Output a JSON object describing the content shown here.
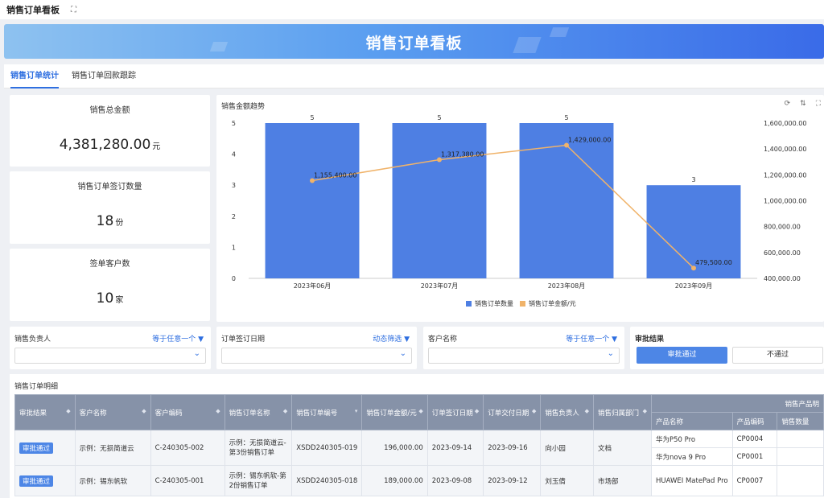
{
  "topbar": {
    "title": "销售订单看板",
    "fullscreen_icon": "expand-icon"
  },
  "banner": {
    "title": "销售订单看板"
  },
  "tabs": [
    {
      "label": "销售订单统计",
      "active": true
    },
    {
      "label": "销售订单回款跟踪",
      "active": false
    }
  ],
  "kpis": [
    {
      "label": "销售总金额",
      "value": "4,381,280.00",
      "unit": "元"
    },
    {
      "label": "销售订单签订数量",
      "value": "18",
      "unit": "份"
    },
    {
      "label": "签单客户数",
      "value": "10",
      "unit": "家"
    }
  ],
  "chart_panel": {
    "title": "销售金额趋势",
    "tools": [
      "refresh-icon",
      "sort-icon",
      "fullscreen-icon"
    ]
  },
  "chart_data": {
    "type": "bar",
    "categories": [
      "2023年06月",
      "2023年07月",
      "2023年08月",
      "2023年09月"
    ],
    "series": [
      {
        "name": "销售订单数量",
        "type": "bar",
        "values": [
          5,
          5,
          5,
          3
        ],
        "labels": [
          "5",
          "5",
          "5",
          "3"
        ],
        "color": "#4e7fe3"
      },
      {
        "name": "销售订单金额/元",
        "type": "line",
        "values": [
          1155400,
          1317380,
          1429000,
          479500
        ],
        "labels": [
          "1,155,400.00",
          "1,317,380.00",
          "1,429,000.00",
          "479,500.00"
        ],
        "color": "#f0b36a"
      }
    ],
    "y_left": {
      "ticks": [
        "0",
        "1",
        "2",
        "3",
        "4",
        "5"
      ],
      "ylim": [
        0,
        5
      ]
    },
    "y_right": {
      "ticks": [
        "400,000.00",
        "600,000.00",
        "800,000.00",
        "1,000,000.00",
        "1,200,000.00",
        "1,400,000.00",
        "1,600,000.00"
      ],
      "ylim": [
        400000,
        1600000
      ]
    },
    "grid": false,
    "legend": "bottom-center"
  },
  "filters": [
    {
      "label": "销售负责人",
      "mode": "等于任意一个 ▼",
      "value": ""
    },
    {
      "label": "订单签订日期",
      "mode": "动态筛选 ▼",
      "value": ""
    },
    {
      "label": "客户名称",
      "mode": "等于任意一个 ▼",
      "value": ""
    }
  ],
  "approval_filter": {
    "label": "审批结果",
    "options": [
      "审批通过",
      "不通过"
    ],
    "selected": "审批通过"
  },
  "table": {
    "title": "销售订单明细",
    "group_header": "销售产品明",
    "headers": [
      "审批结果",
      "客户名称",
      "客户编码",
      "销售订单名称",
      "销售订单编号",
      "销售订单金额/元",
      "订单签订日期",
      "订单交付日期",
      "销售负责人",
      "销售归属部门"
    ],
    "sub_headers": [
      "产品名称",
      "产品编码",
      "销售数量"
    ],
    "rows": [
      {
        "status": "审批通过",
        "customer": "示例：无损简道云",
        "customer_code": "C-240305-002",
        "order_name": "示例：无损简道云-第3份销售订单",
        "order_no": "XSDD240305-019",
        "amount": "196,000.00",
        "sign_date": "2023-09-14",
        "delivery_date": "2023-09-16",
        "owner": "向小园",
        "dept": "文档",
        "products": [
          {
            "name": "华为P50 Pro",
            "code": "CP0004",
            "qty": ""
          },
          {
            "name": "华为nova 9 Pro",
            "code": "CP0001",
            "qty": ""
          }
        ]
      },
      {
        "status": "审批通过",
        "customer": "示例：锡东帆软",
        "customer_code": "C-240305-001",
        "order_name": "示例：锡东帆软-第2份销售订单",
        "order_no": "XSDD240305-018",
        "amount": "189,000.00",
        "sign_date": "2023-09-08",
        "delivery_date": "2023-09-12",
        "owner": "刘玉倩",
        "dept": "市场部",
        "products": [
          {
            "name": "HUAWEI MatePad Pro",
            "code": "CP0007",
            "qty": ""
          }
        ]
      }
    ]
  }
}
